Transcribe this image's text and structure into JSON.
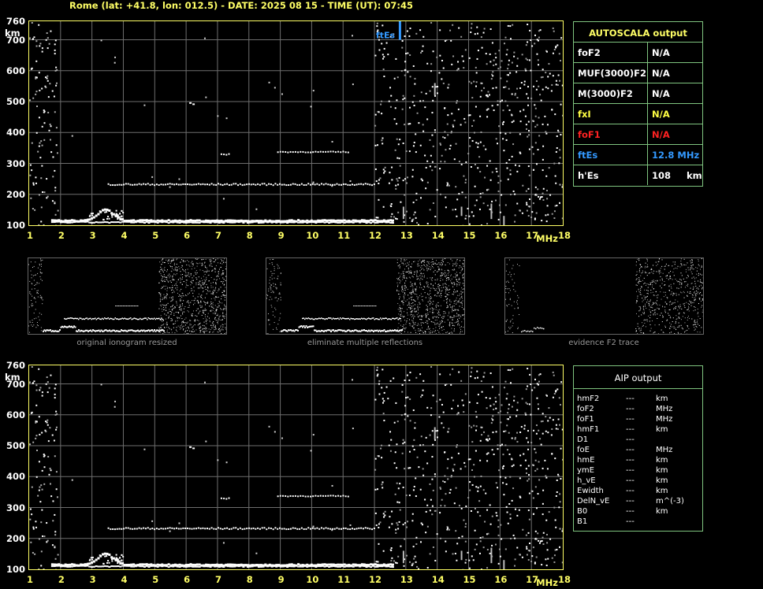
{
  "header": {
    "title": "Rome (lat: +41.8, lon: 012.5) - DATE: 2025 08 15 - TIME (UT): 07:45"
  },
  "axes": {
    "y_unit": "km",
    "y_ticks": [
      "760",
      "700",
      "600",
      "500",
      "400",
      "300",
      "200",
      "100"
    ],
    "x_ticks": [
      "1",
      "2",
      "3",
      "4",
      "5",
      "6",
      "7",
      "8",
      "9",
      "10",
      "11",
      "12",
      "13",
      "14",
      "15",
      "16",
      "17",
      "18"
    ],
    "x_unit": "MHz"
  },
  "marker": {
    "label": "ftEs"
  },
  "autoscala": {
    "title": "AUTOSCALA output",
    "rows": [
      {
        "key": "foF2",
        "value": "N/A",
        "key_color": "#ffffff",
        "value_color": "#ffffff"
      },
      {
        "key": "MUF(3000)F2",
        "value": "N/A",
        "key_color": "#ffffff",
        "value_color": "#ffffff"
      },
      {
        "key": "M(3000)F2",
        "value": "N/A",
        "key_color": "#ffffff",
        "value_color": "#ffffff"
      },
      {
        "key": "fxI",
        "value": "N/A",
        "key_color": "#ffff44",
        "value_color": "#ffff44"
      },
      {
        "key": "foF1",
        "value": "N/A",
        "key_color": "#ff2222",
        "value_color": "#ff2222"
      },
      {
        "key": "ftEs",
        "value": "12.8 MHz",
        "key_color": "#3399ff",
        "value_color": "#3399ff"
      },
      {
        "key": "h'Es",
        "value": "108     km",
        "key_color": "#ffffff",
        "value_color": "#ffffff"
      }
    ]
  },
  "thumbnails": [
    {
      "caption": "original ionogram resized"
    },
    {
      "caption": "eliminate multiple reflections"
    },
    {
      "caption": "evidence F2 trace"
    }
  ],
  "aip": {
    "title": "AIP output",
    "rows": [
      {
        "k": "hmF2",
        "v": "---",
        "u": "km"
      },
      {
        "k": "foF2",
        "v": "---",
        "u": "MHz"
      },
      {
        "k": "foF1",
        "v": "---",
        "u": "MHz"
      },
      {
        "k": "hmF1",
        "v": "---",
        "u": "km"
      },
      {
        "k": "D1",
        "v": "---",
        "u": ""
      },
      {
        "k": "foE",
        "v": "---",
        "u": "MHz"
      },
      {
        "k": "hmE",
        "v": "---",
        "u": "km"
      },
      {
        "k": "ymE",
        "v": "---",
        "u": "km"
      },
      {
        "k": "h_vE",
        "v": "---",
        "u": "km"
      },
      {
        "k": "Ewidth",
        "v": "---",
        "u": "km"
      },
      {
        "k": "DelN_vE",
        "v": "---",
        "u": "m^(-3)"
      },
      {
        "k": "B0",
        "v": "---",
        "u": "km"
      },
      {
        "k": "B1",
        "v": "---",
        "u": ""
      }
    ]
  },
  "colors": {
    "frame": "#ffff66",
    "grid": "#6e6e6e",
    "panel": "#7fc47f",
    "echo": "#ffffff",
    "es": "#3399ff"
  }
}
